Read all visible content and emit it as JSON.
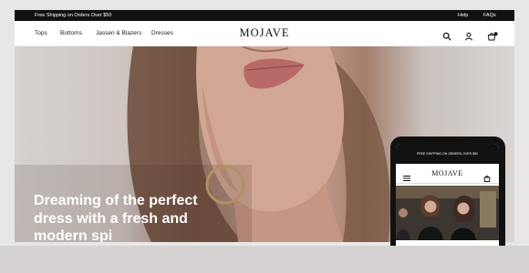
{
  "announcement": {
    "promo": "Free Shipping on Orders Over $50",
    "help": "Help",
    "faqs": "FAQs"
  },
  "nav": {
    "links": [
      "Tops",
      "Bottoms",
      "Jassen & Blazers",
      "Dresses"
    ],
    "logo": "MOJAVE",
    "icons": [
      "search-icon",
      "account-icon",
      "bag-icon"
    ]
  },
  "hero": {
    "headline": "Dreaming of the perfect dress with a fresh and modern spi"
  },
  "phone": {
    "announcement": "FREE SHIPPING ON ORDERS OVER $50",
    "logo": "MOJAVE",
    "icons": [
      "menu-icon",
      "bag-icon"
    ]
  },
  "colors": {
    "topbar": "#111111",
    "page_background": "#e9e6e7",
    "headline": "#ffffff"
  }
}
